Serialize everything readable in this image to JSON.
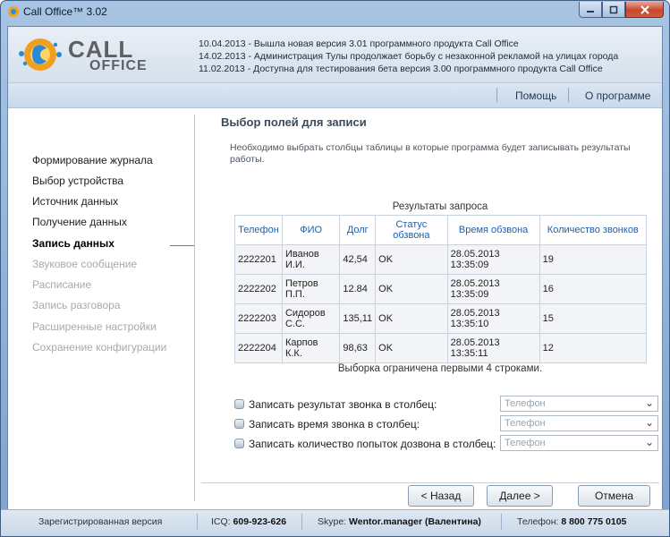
{
  "window": {
    "title": "Call Office™ 3.02"
  },
  "header": {
    "logo_word1": "CALL",
    "logo_word2": "OFFICE",
    "news": [
      "10.04.2013 - Вышла новая версия 3.01 программного продукта Call Office",
      "14.02.2013 - Администрация Тулы продолжает борьбу с незаконной рекламой на улицах города",
      "11.02.2013 - Доступна для тестирования бета версия 3.00 программного продукта Call Office"
    ]
  },
  "nav": {
    "help": "Помощь",
    "about": "О программе"
  },
  "sidebar": {
    "items": [
      {
        "label": "Формирование журнала",
        "state": "normal"
      },
      {
        "label": "Выбор устройства",
        "state": "normal"
      },
      {
        "label": "Источник данных",
        "state": "normal"
      },
      {
        "label": "Получение данных",
        "state": "normal"
      },
      {
        "label": "Запись данных",
        "state": "active"
      },
      {
        "label": "Звуковое сообщение",
        "state": "disabled"
      },
      {
        "label": "Расписание",
        "state": "disabled"
      },
      {
        "label": "Запись разговора",
        "state": "disabled"
      },
      {
        "label": "Расширенные настройки",
        "state": "disabled"
      },
      {
        "label": "Сохранение конфигурации",
        "state": "disabled"
      }
    ]
  },
  "main": {
    "title": "Выбор полей для записи",
    "description": "Необходимо выбрать столбцы таблицы в которые программа будет записывать результаты работы.",
    "table": {
      "caption": "Результаты запроса",
      "columns": [
        "Телефон",
        "ФИО",
        "Долг",
        "Статус обзвона",
        "Время обзвона",
        "Количество звонков"
      ],
      "rows": [
        [
          "2222201",
          "Иванов И.И.",
          "42,54",
          "OK",
          "28.05.2013 13:35:09",
          "19"
        ],
        [
          "2222202",
          "Петров П.П.",
          "12.84",
          "OK",
          "28.05.2013 13:35:09",
          "16"
        ],
        [
          "2222203",
          "Сидоров С.С.",
          "135,11",
          "OK",
          "28.05.2013 13:35:10",
          "15"
        ],
        [
          "2222204",
          "Карпов К.К.",
          "98,63",
          "OK",
          "28.05.2013 13:35:11",
          "12"
        ]
      ],
      "note": "Выборка ограничена первыми 4 строками."
    },
    "options": [
      {
        "label": "Записать результат звонка в столбец:",
        "value": "Телефон"
      },
      {
        "label": "Записать время звонка в столбец:",
        "value": "Телефон"
      },
      {
        "label": "Записать количество попыток дозвона в столбец:",
        "value": "Телефон"
      }
    ]
  },
  "buttons": {
    "back": "< Назад",
    "next": "Далее >",
    "cancel": "Отмена"
  },
  "status": {
    "registered": "Зарегистрированная версия",
    "icq_label": "ICQ:",
    "icq_value": "609-923-626",
    "skype_label": "Skype:",
    "skype_value": "Wentor.manager (Валентина)",
    "phone_label": "Телефон:",
    "phone_value": "8 800 775 0105"
  }
}
